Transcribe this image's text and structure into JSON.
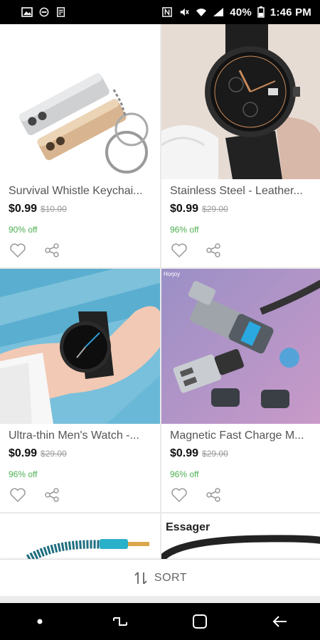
{
  "status_bar": {
    "battery": "40%",
    "time": "1:46 PM",
    "left_icons": [
      "image-icon",
      "do-not-disturb-icon",
      "notes-icon"
    ],
    "right_icons": [
      "nfc-icon",
      "mute-icon",
      "wifi-icon",
      "signal-icon",
      "battery-icon"
    ]
  },
  "products": [
    {
      "title": "Survival Whistle Keychai...",
      "price": "$0.99",
      "old_price": "$10.00",
      "discount": "90% off"
    },
    {
      "title": "Stainless Steel - Leather...",
      "price": "$0.99",
      "old_price": "$29.00",
      "discount": "96% off"
    },
    {
      "title": "Ultra-thin Men's Watch -...",
      "price": "$0.99",
      "old_price": "$29.00",
      "discount": "96% off"
    },
    {
      "title": "Magnetic Fast Charge M...",
      "price": "$0.99",
      "old_price": "$29.00",
      "discount": "96% off"
    }
  ],
  "partial_products": [
    {
      "image_text": ""
    },
    {
      "image_text": "Essager"
    }
  ],
  "image_overlay": {
    "p4_brand": "Horjoy"
  },
  "sort": {
    "label": "SORT"
  },
  "colors": {
    "discount": "#4caf50",
    "status_bar": "#000000",
    "nav_bar": "#000000"
  }
}
